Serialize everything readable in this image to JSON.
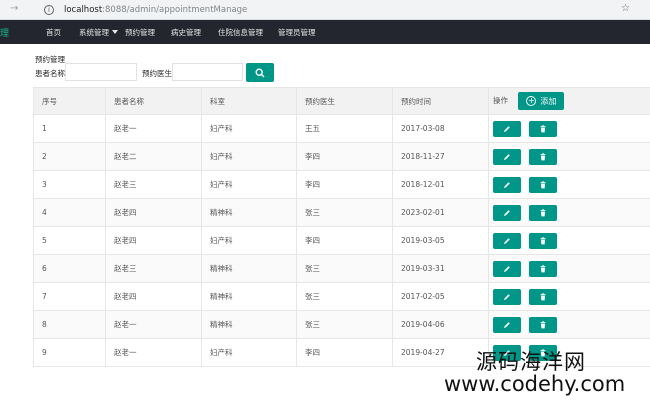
{
  "browser": {
    "url_host": "localhost",
    "url_path": ":8088/admin/appointmentManage"
  },
  "nav": {
    "brand": "理",
    "items": [
      {
        "label": "首页"
      },
      {
        "label": "系统管理"
      },
      {
        "label": "预约管理"
      },
      {
        "label": "病史管理"
      },
      {
        "label": "住院信息管理"
      },
      {
        "label": "管理员管理"
      }
    ]
  },
  "search": {
    "title": "预约管理",
    "patient_label": "患者名称:",
    "patient_value": "",
    "doctor_label": "预约医生:",
    "doctor_value": ""
  },
  "table": {
    "headers": [
      "序号",
      "患者名称",
      "科室",
      "预约医生",
      "预约时间",
      "操作"
    ],
    "add_label": "添加",
    "rows": [
      {
        "id": "1",
        "patient": "赵老一",
        "dept": "妇产科",
        "doctor": "王五",
        "date": "2017-03-08"
      },
      {
        "id": "2",
        "patient": "赵老二",
        "dept": "妇产科",
        "doctor": "李四",
        "date": "2018-11-27"
      },
      {
        "id": "3",
        "patient": "赵老三",
        "dept": "妇产科",
        "doctor": "李四",
        "date": "2018-12-01"
      },
      {
        "id": "4",
        "patient": "赵老四",
        "dept": "精神科",
        "doctor": "张三",
        "date": "2023-02-01"
      },
      {
        "id": "5",
        "patient": "赵老四",
        "dept": "妇产科",
        "doctor": "李四",
        "date": "2019-03-05"
      },
      {
        "id": "6",
        "patient": "赵老三",
        "dept": "精神科",
        "doctor": "张三",
        "date": "2019-03-31"
      },
      {
        "id": "7",
        "patient": "赵老四",
        "dept": "精神科",
        "doctor": "张三",
        "date": "2017-02-05"
      },
      {
        "id": "8",
        "patient": "赵老一",
        "dept": "精神科",
        "doctor": "张三",
        "date": "2019-04-06"
      },
      {
        "id": "9",
        "patient": "赵老一",
        "dept": "妇产科",
        "doctor": "李四",
        "date": "2019-04-27"
      }
    ]
  },
  "watermark": {
    "line1": "源码海洋网",
    "line2": "www.codehy.com"
  },
  "colors": {
    "accent": "#009688",
    "navbar": "#23262e"
  }
}
